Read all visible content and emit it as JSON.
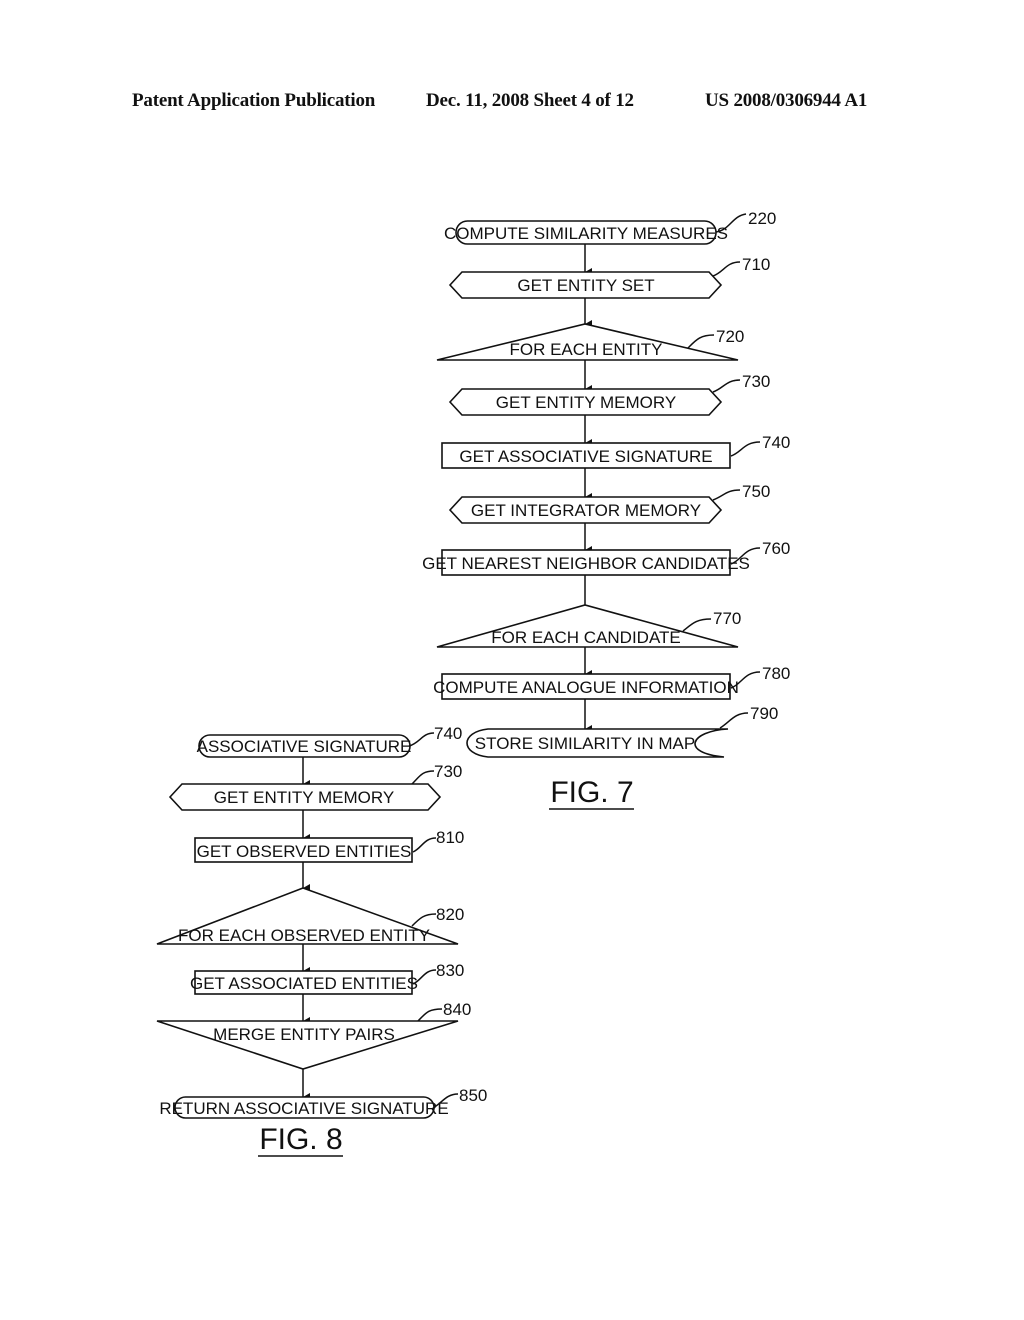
{
  "header": {
    "left": "Patent Application Publication",
    "middle": "Dec. 11, 2008   Sheet 4 of 12",
    "right": "US 2008/0306944 A1"
  },
  "fig7": {
    "caption": "FIG. 7",
    "nodes": [
      {
        "id": "220",
        "shape": "terminal",
        "label": "COMPUTE SIMILARITY MEASURES",
        "ref": "220"
      },
      {
        "id": "710",
        "shape": "hexagon",
        "label": "GET ENTITY SET",
        "ref": "710"
      },
      {
        "id": "720",
        "shape": "loop-start",
        "label": "FOR EACH ENTITY",
        "ref": "720"
      },
      {
        "id": "730",
        "shape": "hexagon",
        "label": "GET ENTITY MEMORY",
        "ref": "730"
      },
      {
        "id": "740",
        "shape": "process",
        "label": "GET ASSOCIATIVE SIGNATURE",
        "ref": "740"
      },
      {
        "id": "750",
        "shape": "hexagon",
        "label": "GET INTEGRATOR MEMORY",
        "ref": "750"
      },
      {
        "id": "760",
        "shape": "process",
        "label": "GET NEAREST NEIGHBOR CANDIDATES",
        "ref": "760"
      },
      {
        "id": "770",
        "shape": "loop-start",
        "label": "FOR EACH CANDIDATE",
        "ref": "770"
      },
      {
        "id": "780",
        "shape": "process",
        "label": "COMPUTE ANALOGUE INFORMATION",
        "ref": "780"
      },
      {
        "id": "790",
        "shape": "stored-data",
        "label": "STORE SIMILARITY IN MAP",
        "ref": "790"
      }
    ]
  },
  "fig8": {
    "caption": "FIG. 8",
    "nodes": [
      {
        "id": "740",
        "shape": "terminal",
        "label": "ASSOCIATIVE SIGNATURE",
        "ref": "740"
      },
      {
        "id": "730",
        "shape": "hexagon",
        "label": "GET ENTITY MEMORY",
        "ref": "730"
      },
      {
        "id": "810",
        "shape": "process",
        "label": "GET OBSERVED ENTITIES",
        "ref": "810"
      },
      {
        "id": "820",
        "shape": "loop-start",
        "label": "FOR EACH OBSERVED ENTITY",
        "ref": "820"
      },
      {
        "id": "830",
        "shape": "process",
        "label": "GET ASSOCIATED ENTITIES",
        "ref": "830"
      },
      {
        "id": "840",
        "shape": "merge",
        "label": "MERGE ENTITY PAIRS",
        "ref": "840"
      },
      {
        "id": "850",
        "shape": "terminal",
        "label": "RETURN ASSOCIATIVE SIGNATURE",
        "ref": "850"
      }
    ]
  }
}
